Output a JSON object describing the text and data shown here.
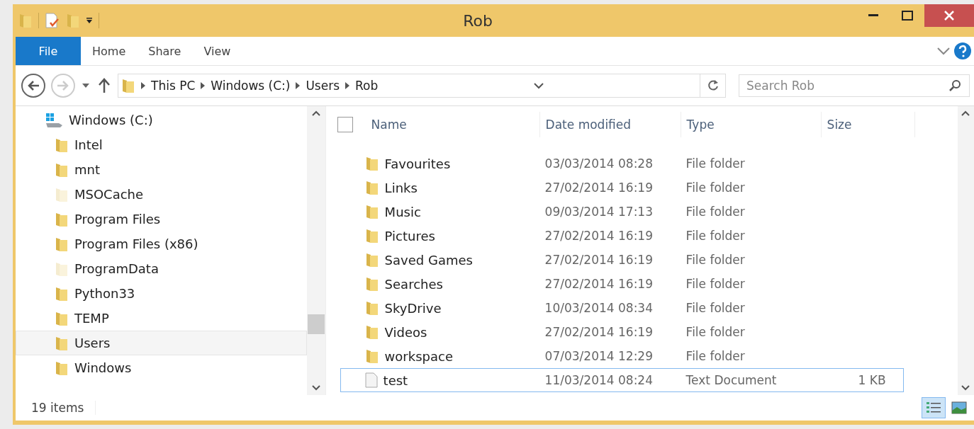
{
  "window": {
    "title": "Rob"
  },
  "ribbon_tabs": [
    {
      "label": "File",
      "selected": true
    },
    {
      "label": "Home",
      "selected": false
    },
    {
      "label": "Share",
      "selected": false
    },
    {
      "label": "View",
      "selected": false
    }
  ],
  "address_bar": {
    "path": [
      "This PC",
      "Windows (C:)",
      "Users",
      "Rob"
    ]
  },
  "search": {
    "placeholder": "Search Rob"
  },
  "navigation": {
    "drive": {
      "label": "Windows (C:)",
      "children": [
        {
          "label": "Intel",
          "hidden": false,
          "selected": false
        },
        {
          "label": "mnt",
          "hidden": false,
          "selected": false
        },
        {
          "label": "MSOCache",
          "hidden": true,
          "selected": false
        },
        {
          "label": "Program Files",
          "hidden": false,
          "selected": false
        },
        {
          "label": "Program Files (x86)",
          "hidden": false,
          "selected": false
        },
        {
          "label": "ProgramData",
          "hidden": true,
          "selected": false
        },
        {
          "label": "Python33",
          "hidden": false,
          "selected": false
        },
        {
          "label": "TEMP",
          "hidden": false,
          "selected": false
        },
        {
          "label": "Users",
          "hidden": false,
          "selected": true
        },
        {
          "label": "Windows",
          "hidden": false,
          "selected": false
        }
      ]
    }
  },
  "table": {
    "select_all": {
      "checked": false
    },
    "columns": [
      "Name",
      "Date modified",
      "Type",
      "Size"
    ],
    "rows": [
      {
        "kind": "folder",
        "name": "Favourites",
        "date": "03/03/2014 08:28",
        "type": "File folder",
        "selected": false
      },
      {
        "kind": "folder",
        "name": "Links",
        "date": "27/02/2014 16:19",
        "type": "File folder",
        "selected": false
      },
      {
        "kind": "folder",
        "name": "Music",
        "date": "09/03/2014 17:13",
        "type": "File folder",
        "selected": false
      },
      {
        "kind": "folder",
        "name": "Pictures",
        "date": "27/02/2014 16:19",
        "type": "File folder",
        "selected": false
      },
      {
        "kind": "folder",
        "name": "Saved Games",
        "date": "27/02/2014 16:19",
        "type": "File folder",
        "selected": false
      },
      {
        "kind": "folder",
        "name": "Searches",
        "date": "27/02/2014 16:19",
        "type": "File folder",
        "selected": false
      },
      {
        "kind": "folder",
        "name": "SkyDrive",
        "date": "10/03/2014 08:34",
        "type": "File folder",
        "selected": false
      },
      {
        "kind": "folder",
        "name": "Videos",
        "date": "27/02/2014 16:19",
        "type": "File folder",
        "selected": false
      },
      {
        "kind": "folder",
        "name": "workspace",
        "date": "07/03/2014 12:29",
        "type": "File folder",
        "selected": false
      },
      {
        "kind": "file",
        "name": "test",
        "date": "11/03/2014 08:24",
        "type": "Text Document",
        "size": "1 KB",
        "selected": true
      }
    ]
  },
  "status_bar": {
    "item_count": "19 items",
    "views": [
      {
        "kind": "details",
        "selected": true
      },
      {
        "kind": "large-icons",
        "selected": false
      }
    ]
  }
}
